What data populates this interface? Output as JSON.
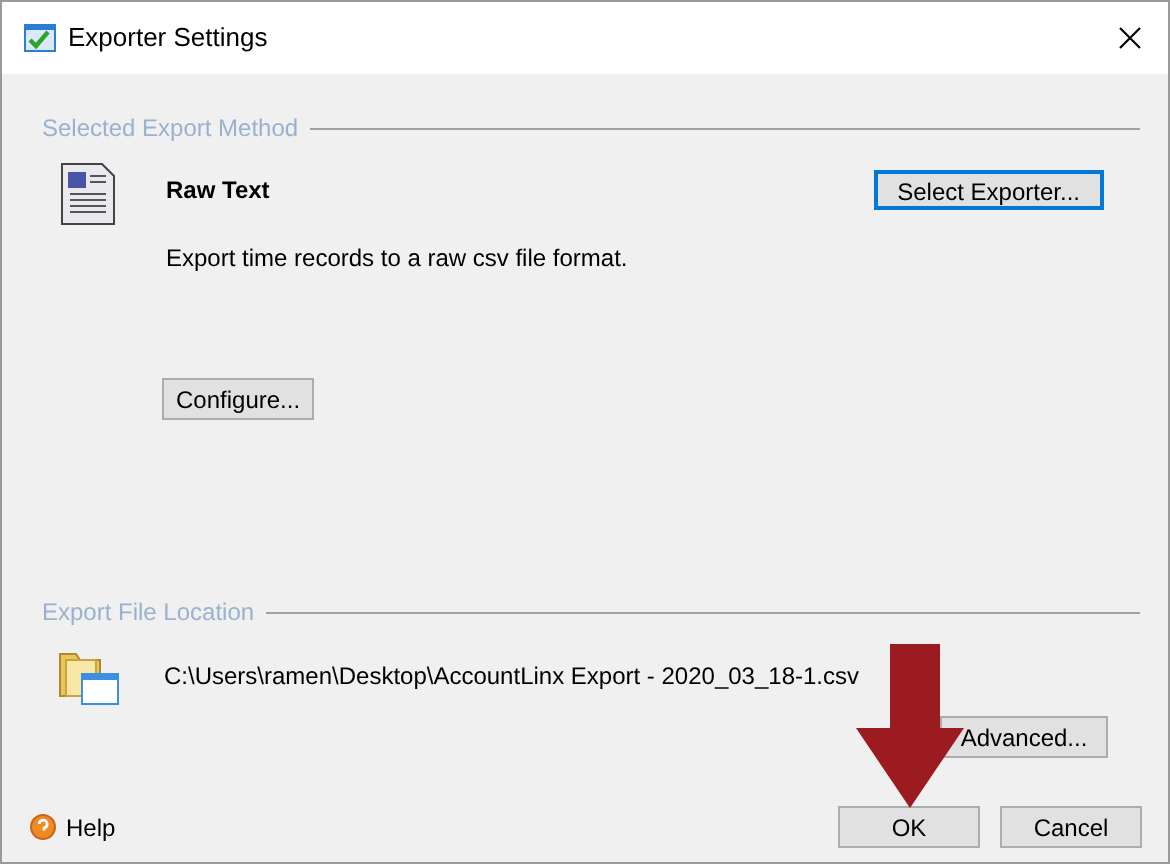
{
  "window": {
    "title": "Exporter Settings"
  },
  "export_method": {
    "heading": "Selected Export Method",
    "name": "Raw Text",
    "description": "Export time records to a raw csv file format.",
    "select_button": {
      "label": "Select Exporter...",
      "focused": true
    },
    "configure_button": "Configure..."
  },
  "file_location": {
    "heading": "Export File Location",
    "path": "C:\\Users\\ramen\\Desktop\\AccountLinx Export - 2020_03_18-1.csv",
    "advanced_button": "Advanced..."
  },
  "help": "Help",
  "buttons": [
    "OK",
    "Cancel"
  ]
}
